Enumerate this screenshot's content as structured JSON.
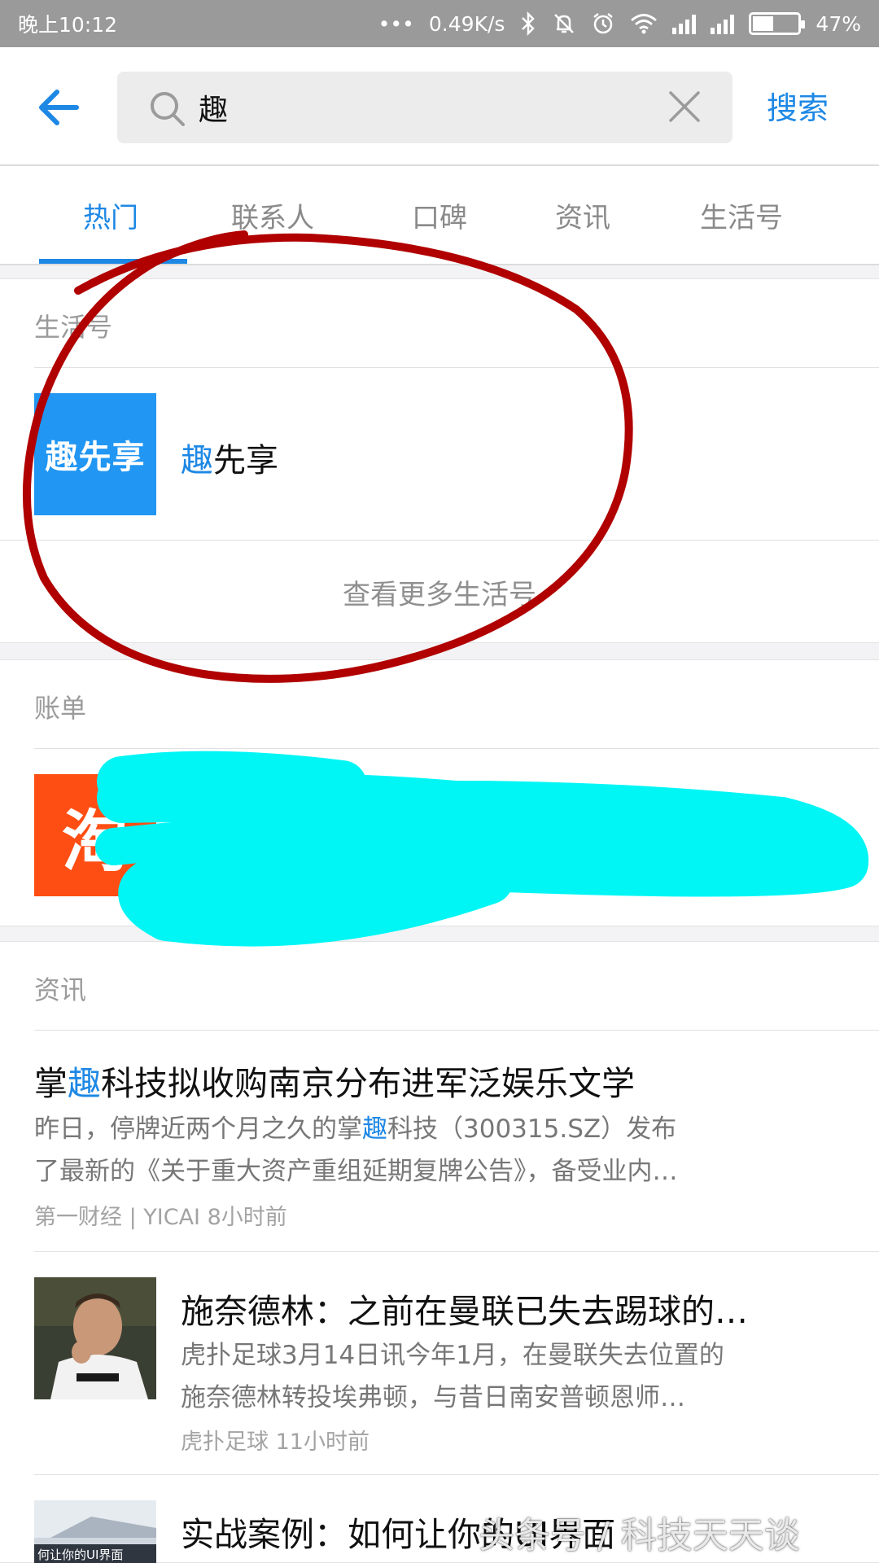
{
  "status_bar": {
    "time": "晚上10:12",
    "dots": "•••",
    "net_speed": "0.49K/s",
    "battery": "47%",
    "battery_level": 0.47,
    "icons": [
      "bluetooth-icon",
      "mute-bell-icon",
      "alarm-icon",
      "wifi-icon",
      "signal-icon",
      "signal-icon",
      "battery-icon"
    ]
  },
  "search": {
    "query": "趣",
    "button": "搜索"
  },
  "tabs": [
    "热门",
    "联系人",
    "口碑",
    "资讯",
    "生活号"
  ],
  "active_tab": "热门",
  "life_section": {
    "title": "生活号",
    "item": {
      "logo_text": "趣先享",
      "name_highlight": "趣",
      "name_rest": "先享"
    },
    "more": "查看更多生活号"
  },
  "bill_section": {
    "title": "账单",
    "item": {
      "logo_text": "淘"
    }
  },
  "news_section": {
    "title": "资讯",
    "items": [
      {
        "title_pre": "掌",
        "title_hl": "趣",
        "title_post": "科技拟收购南京分布进军泛娱乐文学",
        "summary_line1_pre": "昨日，停牌近两个月之久的掌",
        "summary_line1_hl": "趣",
        "summary_line1_post": "科技（300315.SZ）发布",
        "summary_line2": "了最新的《关于重大资产重组延期复牌公告》，备受业内…",
        "meta": "第一财经 | YICAI  8小时前"
      },
      {
        "title": "施奈德林：之前在曼联已失去踢球的…",
        "summary_line1": "虎扑足球3月14日讯今年1月，在曼联失去位置的",
        "summary_line2": "施奈德林转投埃弗顿，与昔日南安普顿恩师…",
        "meta": "虎扑足球  11小时前"
      },
      {
        "title": "实战案例：如何让你的UI界面",
        "thumb_caption": "何让你的UI界面"
      }
    ]
  },
  "watermark": "头条号 / 科技天天谈",
  "colors": {
    "accent": "#1e88e5",
    "qxx_logo": "#2196f3",
    "taobao_logo": "#ff4e14",
    "annotation_circle": "#b00000",
    "redaction": "#00f5f5"
  }
}
